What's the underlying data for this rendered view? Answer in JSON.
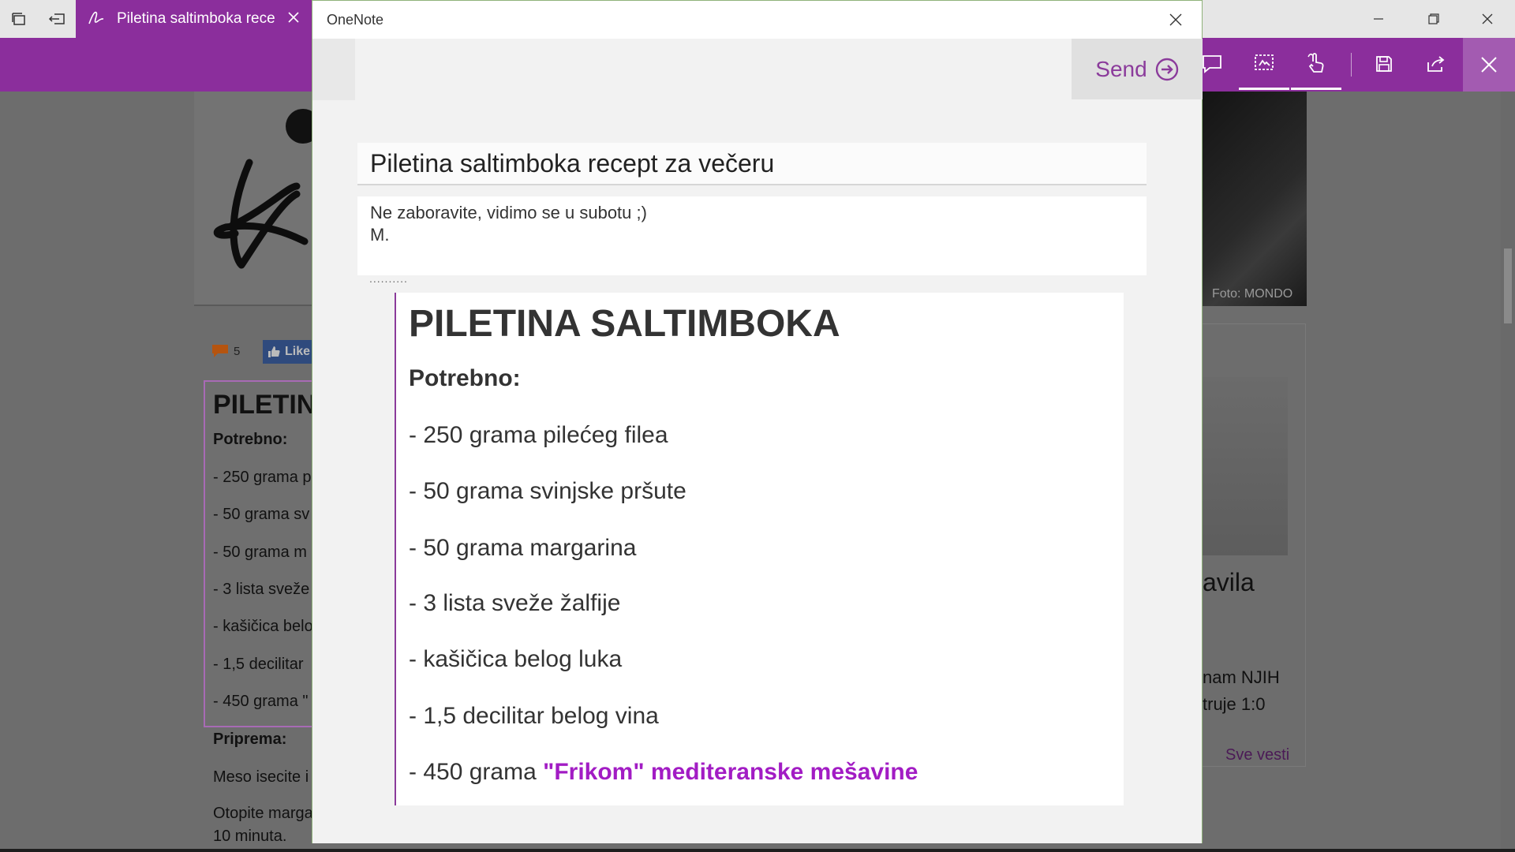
{
  "app": {
    "tab_title": "Piletina saltimboka rece",
    "accent": "#8b2e9c"
  },
  "toolbar": {
    "icons": [
      "comment-icon",
      "clip-icon",
      "touch-write-icon",
      "save-icon",
      "share-icon",
      "close-icon"
    ]
  },
  "background_page": {
    "foto_caption": "Foto: MONDO",
    "comment_count": "5",
    "like_label": "Like",
    "box_title": "PILETINA",
    "box_subtitle": "Potrebno:",
    "box_items": [
      "- 250 grama p",
      "- 50 grama sv",
      "- 50 grama m",
      "- 3 lista sveže",
      "- kašičica belo",
      "- 1,5 decilitar",
      "- 450 grama \""
    ],
    "priprema": "Priprema:",
    "meso": "Meso isecite i",
    "otopite_1": "Otopite marga",
    "otopite_2": "10 minuta.",
    "right_heading": "avila",
    "right_line1": "nam NJIH",
    "right_line2": "truje 1:0",
    "sve_vesti": "Sve vesti"
  },
  "dialog": {
    "title": "OneNote",
    "send_label": "Send",
    "subject": "Piletina saltimboka recept za večeru",
    "note_line1": "Ne zaboravite, vidimo se u subotu ;)",
    "note_line2": "M.",
    "separator": "..........",
    "clip": {
      "heading": "PILETINA SALTIMBOKA",
      "subheading": "Potrebno:",
      "items": [
        "- 250 grama pilećeg filea",
        "- 50 grama svinjske pršute",
        "- 50 grama margarina",
        "- 3 lista sveže žalfije",
        "- kašičica belog luka",
        "- 1,5 decilitar belog vina"
      ],
      "last_item_prefix": "- 450 grama ",
      "last_item_brand": "\"Frikom\" mediteranske mešavine"
    }
  }
}
